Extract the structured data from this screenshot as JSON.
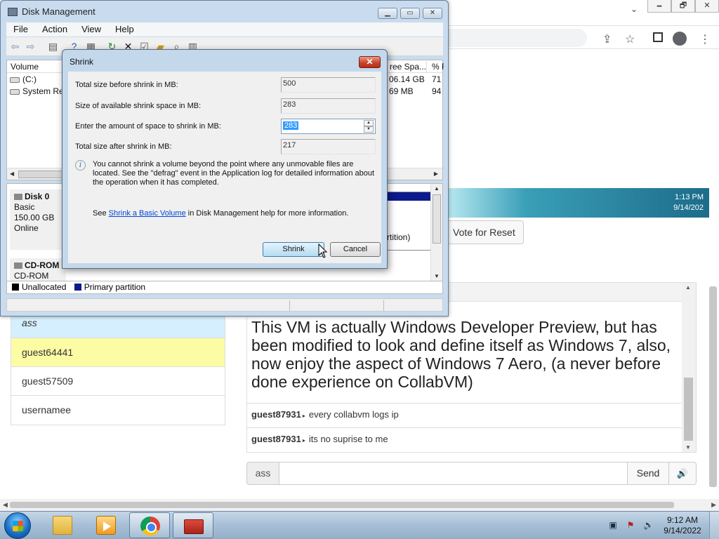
{
  "browser": {
    "window_controls": [
      "🗕",
      "🗗",
      "✕"
    ],
    "banner_time": "1:13 PM",
    "banner_date": "9/14/202",
    "vote_label": "Vote for Reset",
    "users": [
      "ass",
      "guest64441",
      "guest57509",
      "usernamee"
    ],
    "chat": {
      "server_message": "This VM is actually Windows Developer Preview, but has been modified to look and define itself as Windows 7, also, now enjoy the aspect of Windows 7 Aero, (a never before done experience on CollabVM)",
      "messages": [
        {
          "user": "guest87931",
          "text": "every collabvm logs ip"
        },
        {
          "user": "guest87931",
          "text": "its no suprise to me"
        }
      ],
      "username": "ass",
      "input_value": "",
      "send_label": "Send",
      "volume_icon": "🔊"
    }
  },
  "disk_mgmt": {
    "title": "Disk Management",
    "menu": [
      "File",
      "Action",
      "View",
      "Help"
    ],
    "columns": [
      "Volume",
      "ree Spa...",
      "% F"
    ],
    "volumes": [
      {
        "name": "(C:)",
        "free": "06.14 GB",
        "pct": "71"
      },
      {
        "name": "System Res",
        "free": "69 MB",
        "pct": "94"
      }
    ],
    "disks": [
      {
        "name": "Disk 0",
        "type": "Basic",
        "size": "150.00 GB",
        "status": "Online"
      },
      {
        "name": "CD-ROM",
        "type": "CD-ROM (D:)"
      }
    ],
    "partition_text": "rtition)",
    "legend": [
      {
        "label": "Unallocated",
        "color": "#000000"
      },
      {
        "label": "Primary partition",
        "color": "#0b1a8d"
      }
    ]
  },
  "shrink": {
    "title": "Shrink",
    "close_label": "✕",
    "total_before_label": "Total size before shrink in MB:",
    "total_before_value": "500",
    "available_label": "Size of available shrink space in MB:",
    "available_value": "283",
    "amount_label": "Enter the amount of space to shrink in MB:",
    "amount_value": "283",
    "total_after_label": "Total size after shrink in MB:",
    "total_after_value": "217",
    "info_text": "You cannot shrink a volume beyond the point where any unmovable files are located. See the \"defrag\" event in the Application log for detailed information about the operation when it has completed.",
    "help_prefix": "See ",
    "help_link": "Shrink a Basic Volume",
    "help_suffix": " in Disk Management help for more information.",
    "shrink_button": "Shrink",
    "cancel_button": "Cancel"
  },
  "taskbar": {
    "time": "9:12 AM",
    "date": "9/14/2022"
  },
  "colors": {
    "banner": "#1c6c8a",
    "user_self": "#d6efff",
    "user_highlight": "#fcfca4",
    "taskbar": "#a9c1d8"
  }
}
